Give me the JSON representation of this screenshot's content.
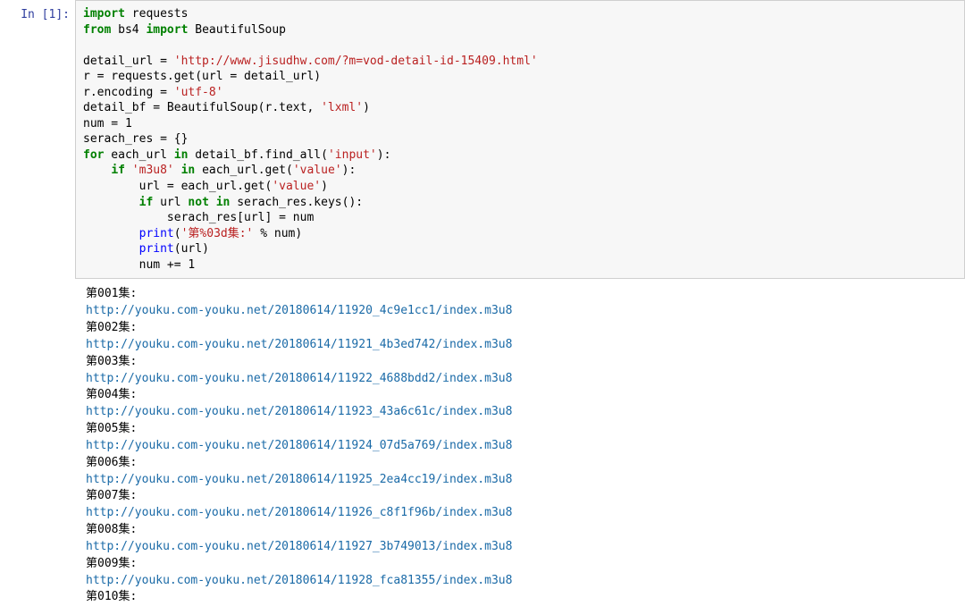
{
  "prompt": "In [1]:",
  "code_tokens": [
    [
      "kw-green",
      "import"
    ],
    [
      "plain",
      " requests\n"
    ],
    [
      "kw-green",
      "from"
    ],
    [
      "plain",
      " bs4 "
    ],
    [
      "kw-green",
      "import"
    ],
    [
      "plain",
      " BeautifulSoup\n\n"
    ],
    [
      "plain",
      "detail_url = "
    ],
    [
      "str",
      "'http://www.jisudhw.com/?m=vod-detail-id-15409.html'"
    ],
    [
      "plain",
      "\n"
    ],
    [
      "plain",
      "r = requests.get(url = detail_url)\n"
    ],
    [
      "plain",
      "r.encoding = "
    ],
    [
      "str",
      "'utf-8'"
    ],
    [
      "plain",
      "\n"
    ],
    [
      "plain",
      "detail_bf = BeautifulSoup(r.text, "
    ],
    [
      "str",
      "'lxml'"
    ],
    [
      "plain",
      ")\n"
    ],
    [
      "plain",
      "num = 1\n"
    ],
    [
      "plain",
      "serach_res = {}\n"
    ],
    [
      "kw-green",
      "for"
    ],
    [
      "plain",
      " each_url "
    ],
    [
      "kw-green",
      "in"
    ],
    [
      "plain",
      " detail_bf.find_all("
    ],
    [
      "str",
      "'input'"
    ],
    [
      "plain",
      "):\n"
    ],
    [
      "plain",
      "    "
    ],
    [
      "kw-green",
      "if"
    ],
    [
      "plain",
      " "
    ],
    [
      "str",
      "'m3u8'"
    ],
    [
      "plain",
      " "
    ],
    [
      "kw-green",
      "in"
    ],
    [
      "plain",
      " each_url.get("
    ],
    [
      "str",
      "'value'"
    ],
    [
      "plain",
      "):\n"
    ],
    [
      "plain",
      "        url = each_url.get("
    ],
    [
      "str",
      "'value'"
    ],
    [
      "plain",
      ")\n"
    ],
    [
      "plain",
      "        "
    ],
    [
      "kw-green",
      "if"
    ],
    [
      "plain",
      " url "
    ],
    [
      "kw-green",
      "not"
    ],
    [
      "plain",
      " "
    ],
    [
      "kw-green",
      "in"
    ],
    [
      "plain",
      " serach_res.keys():\n"
    ],
    [
      "plain",
      "            serach_res[url] = num\n"
    ],
    [
      "plain",
      "        "
    ],
    [
      "kw-blue",
      "print"
    ],
    [
      "plain",
      "("
    ],
    [
      "str",
      "'第%03d集:'"
    ],
    [
      "plain",
      " % num)\n"
    ],
    [
      "plain",
      "        "
    ],
    [
      "kw-blue",
      "print"
    ],
    [
      "plain",
      "(url)\n"
    ],
    [
      "plain",
      "        num += 1"
    ]
  ],
  "output_lines": [
    {
      "type": "label",
      "text": "第001集:"
    },
    {
      "type": "url",
      "text": "http://youku.com-youku.net/20180614/11920_4c9e1cc1/index.m3u8"
    },
    {
      "type": "label",
      "text": "第002集:"
    },
    {
      "type": "url",
      "text": "http://youku.com-youku.net/20180614/11921_4b3ed742/index.m3u8"
    },
    {
      "type": "label",
      "text": "第003集:"
    },
    {
      "type": "url",
      "text": "http://youku.com-youku.net/20180614/11922_4688bdd2/index.m3u8"
    },
    {
      "type": "label",
      "text": "第004集:"
    },
    {
      "type": "url",
      "text": "http://youku.com-youku.net/20180614/11923_43a6c61c/index.m3u8"
    },
    {
      "type": "label",
      "text": "第005集:"
    },
    {
      "type": "url",
      "text": "http://youku.com-youku.net/20180614/11924_07d5a769/index.m3u8"
    },
    {
      "type": "label",
      "text": "第006集:"
    },
    {
      "type": "url",
      "text": "http://youku.com-youku.net/20180614/11925_2ea4cc19/index.m3u8"
    },
    {
      "type": "label",
      "text": "第007集:"
    },
    {
      "type": "url",
      "text": "http://youku.com-youku.net/20180614/11926_c8f1f96b/index.m3u8"
    },
    {
      "type": "label",
      "text": "第008集:"
    },
    {
      "type": "url",
      "text": "http://youku.com-youku.net/20180614/11927_3b749013/index.m3u8"
    },
    {
      "type": "label",
      "text": "第009集:"
    },
    {
      "type": "url",
      "text": "http://youku.com-youku.net/20180614/11928_fca81355/index.m3u8"
    },
    {
      "type": "label",
      "text": "第010集:"
    }
  ]
}
